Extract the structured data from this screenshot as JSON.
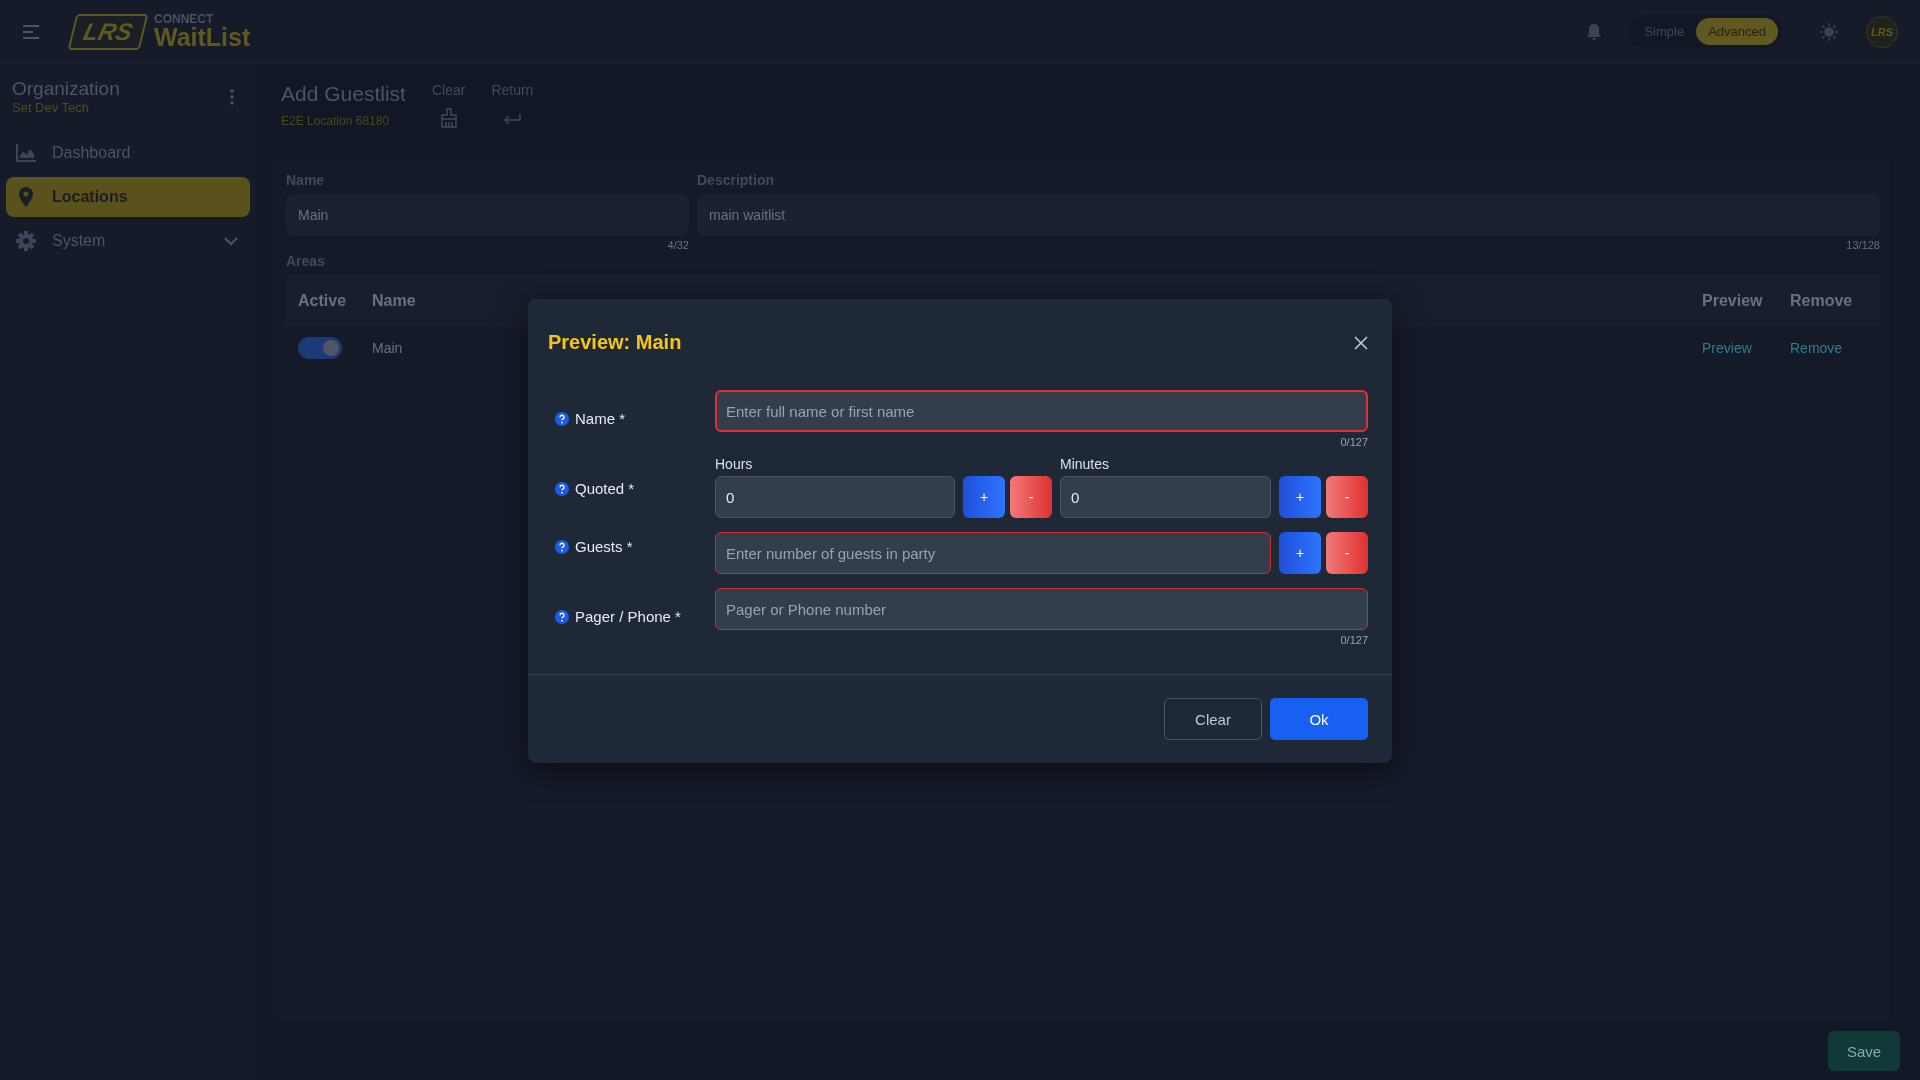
{
  "header": {
    "logo_text": "LRS",
    "brand_small": "CONNECT",
    "brand": "WaitList",
    "modes": [
      {
        "label": "Simple",
        "selected": false
      },
      {
        "label": "Advanced",
        "selected": true
      }
    ],
    "avatar_text": "LRS"
  },
  "sidebar": {
    "org_title": "Organization",
    "org_name": "Set Dev Tech",
    "items": [
      {
        "label": "Dashboard",
        "kind": "chart",
        "selected": false
      },
      {
        "label": "Locations",
        "kind": "pin",
        "selected": true
      },
      {
        "label": "System",
        "kind": "gear",
        "selected": false,
        "expanded": false
      }
    ]
  },
  "page": {
    "title": "Add Guestlist",
    "subtitle": "E2E Location 68180",
    "actions": [
      {
        "label": "Clear",
        "kind": "broom"
      },
      {
        "label": "Return",
        "kind": "return"
      }
    ]
  },
  "form": {
    "fields": [
      {
        "label": "Name",
        "value": "Main",
        "counter": "4/32"
      },
      {
        "label": "Description",
        "value": "main waitlist",
        "counter": "13/128"
      }
    ],
    "areas_label": "Areas",
    "table": {
      "columns": [
        "Active",
        "Name",
        "Preview",
        "Remove"
      ],
      "rows": [
        {
          "active": true,
          "name": "Main",
          "preview": "Preview",
          "remove": "Remove"
        }
      ]
    }
  },
  "save_button": "Save",
  "dialog": {
    "title": "Preview: Main",
    "rows": [
      {
        "kind": "text",
        "label": "Name *",
        "placeholder": "Enter full name or first name",
        "counter": "0/127",
        "invalid": true,
        "focused": true
      },
      {
        "kind": "duration",
        "label": "Quoted *",
        "parts": [
          {
            "label": "Hours",
            "value": "0",
            "plus": "+",
            "minus": "-"
          },
          {
            "label": "Minutes",
            "value": "0",
            "plus": "+",
            "minus": "-"
          }
        ]
      },
      {
        "kind": "stepper",
        "label": "Guests *",
        "placeholder": "Enter number of guests in party",
        "invalid": true,
        "plus": "+",
        "minus": "-"
      },
      {
        "kind": "text",
        "label": "Pager / Phone *",
        "placeholder": "Pager or Phone number",
        "counter": "0/127",
        "invalid": true,
        "focused": false
      }
    ],
    "buttons": [
      {
        "label": "Clear",
        "kind": "secondary"
      },
      {
        "label": "Ok",
        "kind": "primary"
      }
    ]
  }
}
